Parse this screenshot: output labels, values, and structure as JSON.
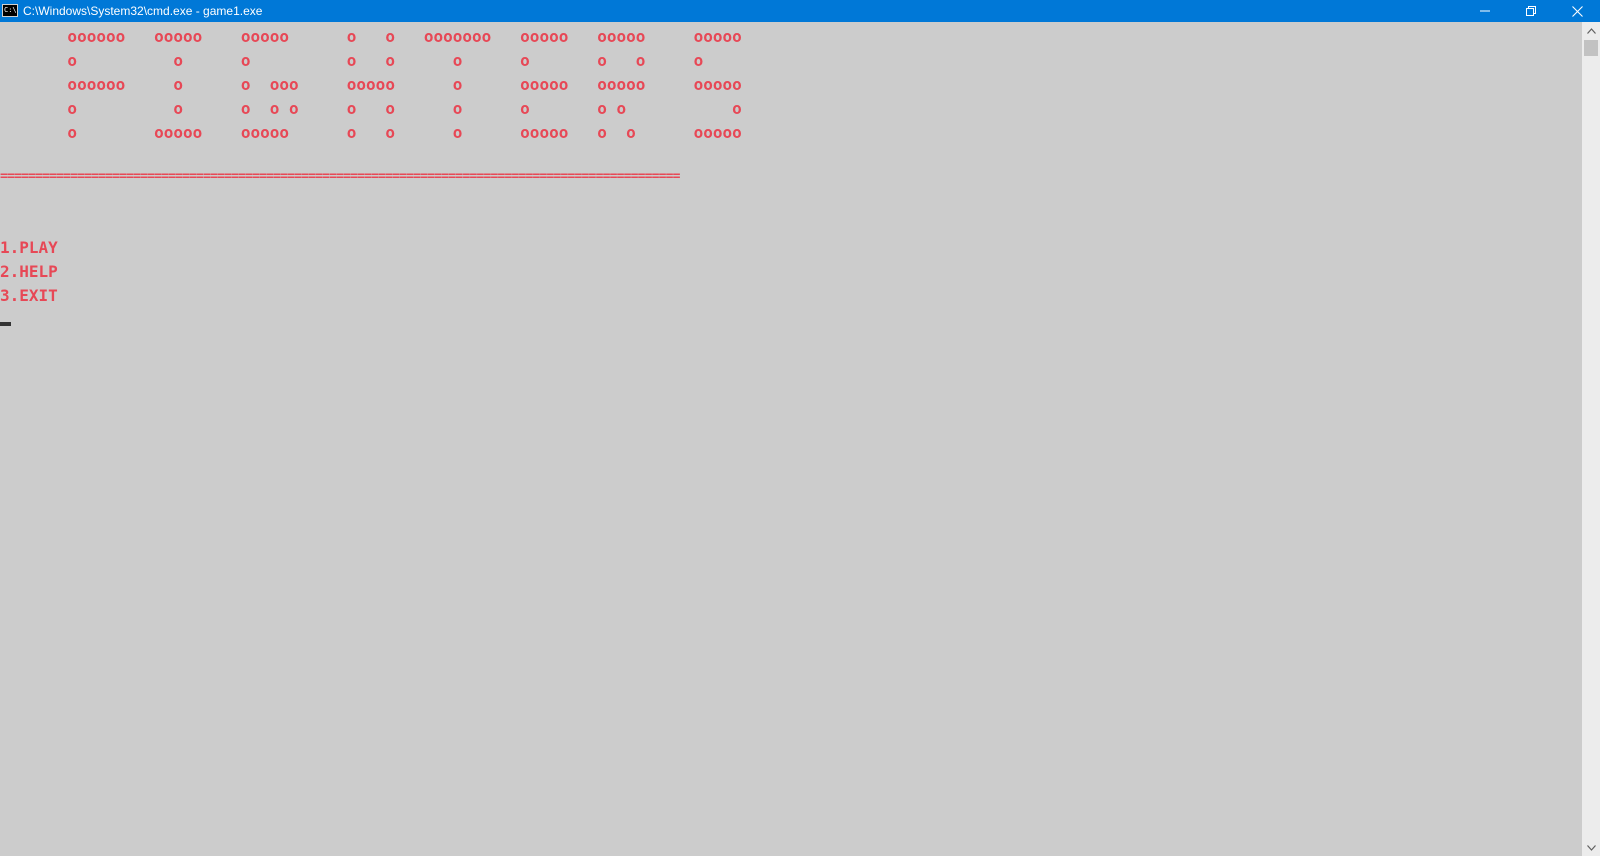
{
  "window": {
    "title": "C:\\Windows\\System32\\cmd.exe - game1.exe",
    "icon_text": "C:\\."
  },
  "title_art": [
    "       oooooo   ooooo    ooooo      o   o   ooooooo   ooooo   ooooo     ooooo",
    "       o          o      o          o   o      o      o       o   o     o",
    "       oooooo     o      o  ooo     ooooo      o      ooooo   ooooo     ooooo",
    "       o          o      o  o o     o   o      o      o       o o           o",
    "       o        ooooo    ooooo      o   o      o      ooooo   o  o      ooooo"
  ],
  "separator": "=================================================================================================",
  "menu": {
    "items": [
      "1.PLAY",
      "2.HELP",
      "3.EXIT"
    ]
  },
  "colors": {
    "console_background": "#cccccc",
    "text": "#e74856",
    "titlebar": "#0078d7",
    "cursor": "#333333"
  },
  "icons": {
    "window_icon": "cmd-icon",
    "minimize": "minimize-icon",
    "maximize": "restore-icon",
    "close": "close-icon",
    "scroll_up": "chevron-up-icon",
    "scroll_down": "chevron-down-icon"
  }
}
